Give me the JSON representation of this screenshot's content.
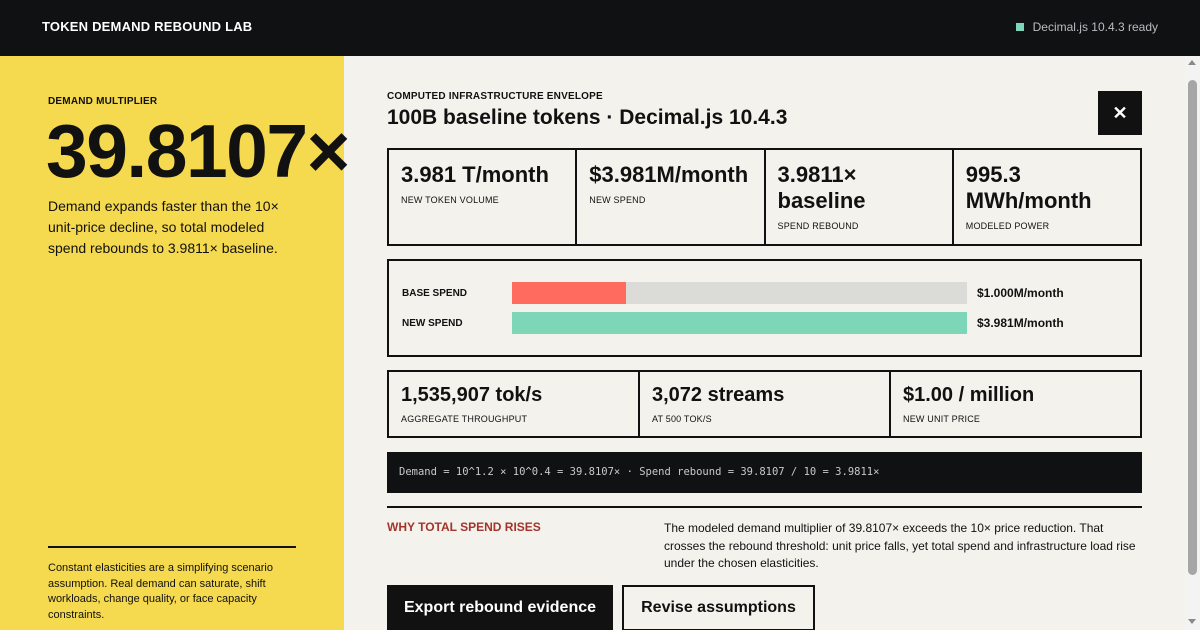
{
  "header": {
    "brand": "TOKEN DEMAND REBOUND LAB",
    "status_text": "Decimal.js 10.4.3 ready",
    "status_color": "#7dd6b8"
  },
  "left_panel": {
    "eyebrow": "DEMAND MULTIPLIER",
    "multiplier": "39.8107×",
    "lede": "Demand expands faster than the 10× unit-price decline, so total modeled spend rebounds to 3.9811× baseline.",
    "footnote": "Constant elasticities are a simplifying scenario assumption. Real demand can saturate, shift workloads, change quality, or face capacity constraints.",
    "background": "#f5d94f"
  },
  "main": {
    "eyebrow": "COMPUTED INFRASTRUCTURE ENVELOPE",
    "title": "100B baseline tokens · Decimal.js 10.4.3",
    "close_label": "✕",
    "stats": [
      {
        "value": "3.981 T/month",
        "label": "NEW TOKEN VOLUME"
      },
      {
        "value": "$3.981M/month",
        "label": "NEW SPEND"
      },
      {
        "value": "3.9811× baseline",
        "label": "SPEND REBOUND"
      },
      {
        "value": "995.3 MWh/month",
        "label": "MODELED POWER"
      }
    ],
    "spend_bars": [
      {
        "label": "BASE SPEND",
        "amount": "$1.000M/month",
        "fraction": 0.2512,
        "color": "#ff6b5e"
      },
      {
        "label": "NEW SPEND",
        "amount": "$3.981M/month",
        "fraction": 1.0,
        "color": "#7dd6b8"
      }
    ],
    "stats2": [
      {
        "value": "1,535,907 tok/s",
        "label": "AGGREGATE THROUGHPUT"
      },
      {
        "value": "3,072 streams",
        "label": "AT 500 TOK/S"
      },
      {
        "value": "$1.00 / million",
        "label": "NEW UNIT PRICE"
      }
    ],
    "formula": "Demand = 10^1.2 × 10^0.4 = 39.8107× · Spend rebound = 39.8107 / 10 = 3.9811×",
    "why_title": "WHY TOTAL SPEND RISES",
    "why_body": "The modeled demand multiplier of 39.8107× exceeds the 10× price reduction. That crosses the rebound threshold: unit price falls, yet total spend and infrastructure load rise under the chosen elasticities.",
    "primary_button": "Export rebound evidence",
    "secondary_button": "Revise assumptions",
    "accent_red": "#a3342c"
  }
}
